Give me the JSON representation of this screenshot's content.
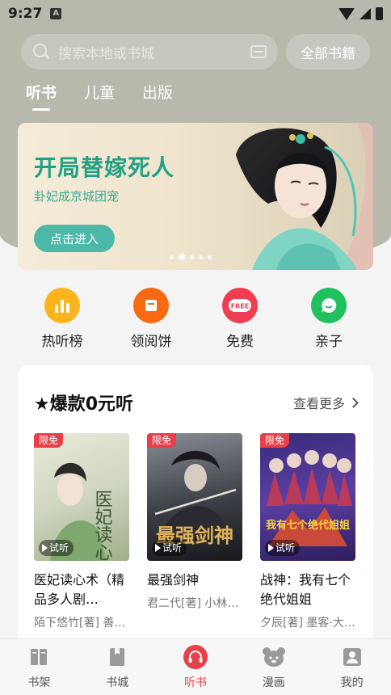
{
  "status_bar": {
    "time": "9:27",
    "notification_glyph": "A"
  },
  "search": {
    "placeholder": "搜索本地或书城",
    "all_books_label": "全部书籍"
  },
  "tabs": [
    {
      "label": "听书",
      "active": true
    },
    {
      "label": "儿童",
      "active": false
    },
    {
      "label": "出版",
      "active": false
    }
  ],
  "banner": {
    "title": "开局替嫁死人",
    "subtitle": "卦妃成京城团宠",
    "button_label": "点击进入",
    "page_count": 5,
    "current_page": 2
  },
  "quick_links": [
    {
      "label": "热听榜",
      "icon": "chart-bars-icon",
      "color": "#fbb41b"
    },
    {
      "label": "领阅饼",
      "icon": "envelope-icon",
      "color": "#f76a12"
    },
    {
      "label": "免费",
      "icon": "free-tag-icon",
      "color": "#ef3d52",
      "icon_text": "FREE"
    },
    {
      "label": "亲子",
      "icon": "chat-bubble-icon",
      "color": "#21c05e"
    }
  ],
  "section": {
    "title": "★爆款0元听",
    "more_label": "查看更多",
    "books": [
      {
        "badge": "限免",
        "listen_label": "试听",
        "name": "医妃读心术（精品多人剧…",
        "author": "陌下悠竹[著] 善…",
        "cover_text": "医妃读心术"
      },
      {
        "badge": "限免",
        "listen_label": "试听",
        "name": "最强剑神",
        "author": "君二代[著] 小林…",
        "cover_text": "最强剑神"
      },
      {
        "badge": "限免",
        "listen_label": "试听",
        "name": "战神：我有七个绝代姐姐",
        "author": "夕辰[著] 墨客·大…",
        "cover_text": "我有七个绝代姐姐"
      }
    ]
  },
  "bottom_nav": [
    {
      "label": "书架",
      "icon": "bookshelf-icon",
      "active": false
    },
    {
      "label": "书城",
      "icon": "bookstore-icon",
      "active": false
    },
    {
      "label": "听书",
      "icon": "headphones-icon",
      "active": true
    },
    {
      "label": "漫画",
      "icon": "comic-bear-icon",
      "active": false
    },
    {
      "label": "我的",
      "icon": "profile-icon",
      "active": false
    }
  ],
  "colors": {
    "accent": "#e8404a",
    "banner_title": "#21a085",
    "banner_button": "#4cb8a7",
    "top_background": "#b9b8ad"
  }
}
